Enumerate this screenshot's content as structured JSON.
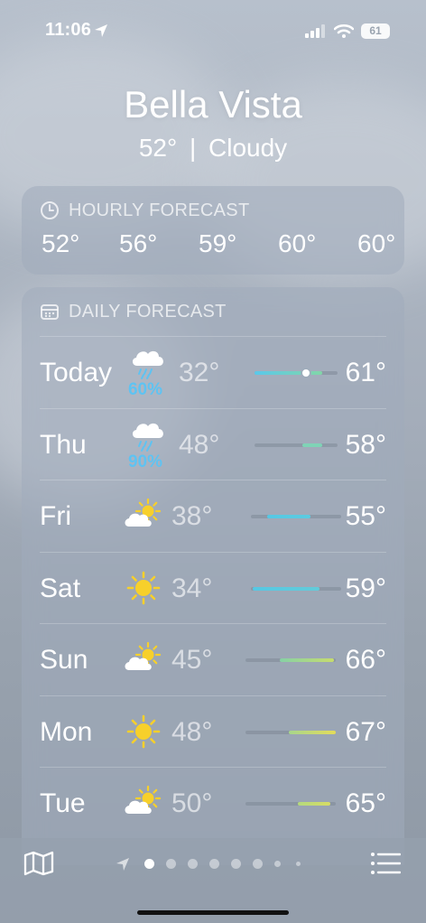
{
  "status_bar": {
    "time": "11:06",
    "battery": "61"
  },
  "header": {
    "city": "Bella Vista",
    "temperature": "52°",
    "separator": "|",
    "condition": "Cloudy"
  },
  "hourly": {
    "title": "HOURLY FORECAST",
    "temps": [
      "52°",
      "56°",
      "59°",
      "60°",
      "60°"
    ]
  },
  "daily": {
    "title": "DAILY FORECAST",
    "days": [
      {
        "day": "Today",
        "icon": "rain-cloud-icon",
        "precip": "60%",
        "low": "32°",
        "high": "61°",
        "range": [
          0.0,
          0.82
        ],
        "current": 0.62,
        "color": "#5bc8ea",
        "color2": "#82d6a8"
      },
      {
        "day": "Thu",
        "icon": "rain-cloud-icon",
        "precip": "90%",
        "low": "48°",
        "high": "58°",
        "range": [
          0.58,
          0.82
        ],
        "color": "#7fd3b6",
        "color2": "#7fd3b6"
      },
      {
        "day": "Fri",
        "icon": "partly-sunny-icon",
        "precip": "",
        "low": "38°",
        "high": "55°",
        "range": [
          0.18,
          0.66
        ],
        "color": "#55c8e4",
        "color2": "#5ccbe0"
      },
      {
        "day": "Sat",
        "icon": "sun-icon",
        "precip": "",
        "low": "34°",
        "high": "59°",
        "range": [
          0.02,
          0.76
        ],
        "color": "#55c8e4",
        "color2": "#63cbd9"
      },
      {
        "day": "Sun",
        "icon": "partly-sunny-icon",
        "precip": "",
        "low": "45°",
        "high": "66°",
        "range": [
          0.38,
          0.98
        ],
        "color": "#86d1a6",
        "color2": "#c7dc6d"
      },
      {
        "day": "Mon",
        "icon": "sun-icon",
        "precip": "",
        "low": "48°",
        "high": "67°",
        "range": [
          0.48,
          1.0
        ],
        "color": "#a7d58c",
        "color2": "#e4dc5a"
      },
      {
        "day": "Tue",
        "icon": "partly-sunny-icon",
        "precip": "",
        "low": "50°",
        "high": "65°",
        "range": [
          0.58,
          0.94
        ],
        "color": "#b4d97e",
        "color2": "#d7dc64"
      }
    ]
  },
  "bottom_bar": {
    "map_icon": "map-icon",
    "list_icon": "list-icon",
    "page_count": 8,
    "active_page": 0
  },
  "colors": {
    "precip": "#5ec3f2",
    "sun": "#f7d02b"
  }
}
